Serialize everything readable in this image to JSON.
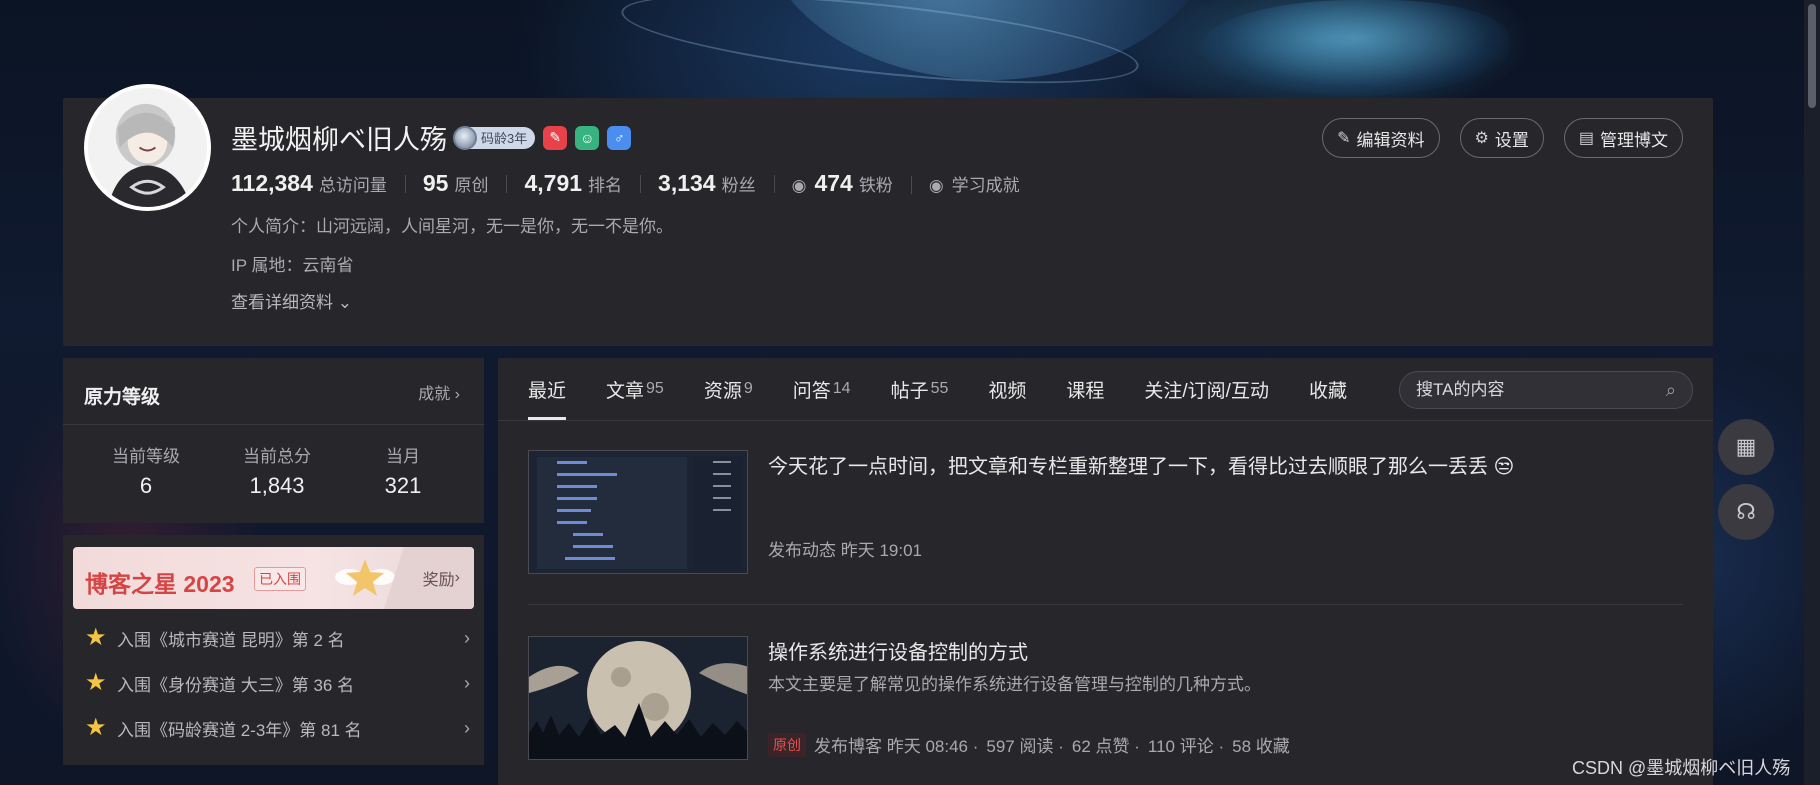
{
  "profile": {
    "name": "墨城烟柳ベ旧人殇",
    "code_age": "码龄3年",
    "stats": [
      {
        "num": "112,384",
        "label": "总访问量"
      },
      {
        "num": "95",
        "label": "原创"
      },
      {
        "num": "4,791",
        "label": "排名"
      },
      {
        "num": "3,134",
        "label": "粉丝"
      },
      {
        "num": "474",
        "label": "铁粉"
      }
    ],
    "achievement_label": "学习成就",
    "bio": "个人简介：山河远阔，人间星河，无一是你，无一不是你。",
    "ip": "IP 属地：云南省",
    "detail_link": "查看详细资料",
    "actions": {
      "edit": "编辑资料",
      "settings": "设置",
      "manage": "管理博文"
    },
    "icons": [
      "code-age-medal-icon",
      "red-badge-icon",
      "green-badge-icon",
      "male-icon"
    ]
  },
  "level": {
    "title": "原力等级",
    "link": "成就",
    "cols": [
      {
        "label": "当前等级",
        "value": "6"
      },
      {
        "label": "当前总分",
        "value": "1,843"
      },
      {
        "label": "当月",
        "value": "321"
      }
    ]
  },
  "star": {
    "title": "博客之星 2023",
    "tag": "已入围",
    "reward": "奖励",
    "items": [
      "入围《城市赛道 昆明》第 2 名",
      "入围《身份赛道 大三》第 36 名",
      "入围《码龄赛道 2-3年》第 81 名"
    ]
  },
  "tabs": [
    {
      "label": "最近",
      "count": ""
    },
    {
      "label": "文章",
      "count": "95"
    },
    {
      "label": "资源",
      "count": "9"
    },
    {
      "label": "问答",
      "count": "14"
    },
    {
      "label": "帖子",
      "count": "55"
    },
    {
      "label": "视频",
      "count": ""
    },
    {
      "label": "课程",
      "count": ""
    },
    {
      "label": "关注/订阅/互动",
      "count": ""
    },
    {
      "label": "收藏",
      "count": ""
    }
  ],
  "search": {
    "placeholder": "搜TA的内容"
  },
  "posts": [
    {
      "title": "今天花了一点时间，把文章和专栏重新整理了一下，看得比过去顺眼了那么一丢丢 😒",
      "meta": "发布动态 昨天 19:01"
    },
    {
      "title": "操作系统进行设备控制的方式",
      "desc": "本文主要是了解常见的操作系统进行设备管理与控制的几种方式。",
      "orig": "原创",
      "meta_type": "发布博客 昨天 08:46 ·",
      "reads": "597 阅读 ·",
      "likes": "62 点赞 ·",
      "comments": "110 评论 ·",
      "favs": "58 收藏"
    }
  ],
  "watermark": "CSDN @墨城烟柳ベ旧人殇"
}
